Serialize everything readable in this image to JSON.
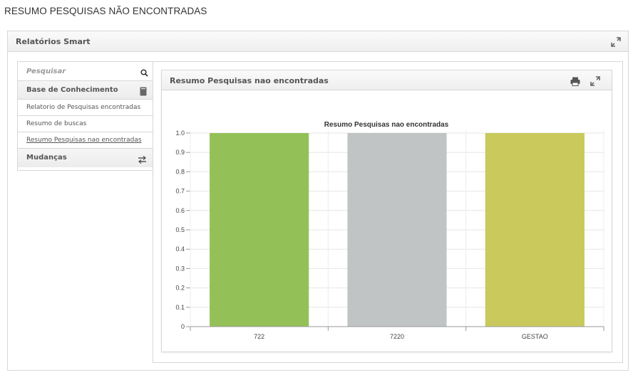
{
  "page": {
    "title": "RESUMO PESQUISAS NÃO ENCONTRADAS"
  },
  "panel": {
    "title": "Relatórios Smart"
  },
  "sidebar": {
    "search_placeholder": "Pesquisar",
    "sections": [
      {
        "label": "Base de Conhecimento",
        "icon": "book-icon"
      },
      {
        "label": "Mudanças",
        "icon": "swap-icon"
      }
    ],
    "items": [
      {
        "label": "Relatorio de Pesquisas encontradas",
        "active": false
      },
      {
        "label": "Resumo de buscas",
        "active": false
      },
      {
        "label": "Resumo Pesquisas nao encontradas",
        "active": true
      }
    ]
  },
  "chart_panel": {
    "title": "Resumo Pesquisas nao encontradas"
  },
  "colors": {
    "bar1": "#94c157",
    "bar2": "#c1c4c4",
    "bar3": "#c9c95c"
  },
  "chart_data": {
    "type": "bar",
    "title": "Resumo Pesquisas nao encontradas",
    "categories": [
      "722",
      "7220",
      "GESTAO"
    ],
    "values": [
      1.0,
      1.0,
      1.0
    ],
    "ylim": [
      0,
      1.0
    ],
    "yticks": [
      "0",
      "0.1",
      "0.2",
      "0.3",
      "0.4",
      "0.5",
      "0.6",
      "0.7",
      "0.8",
      "0.9",
      "1.0"
    ],
    "xlabel": "",
    "ylabel": "",
    "grid": true
  }
}
